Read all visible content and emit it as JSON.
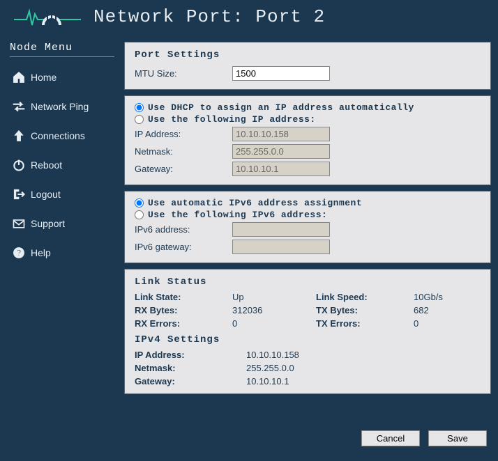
{
  "header": {
    "title": "Network Port: Port 2"
  },
  "sidebar": {
    "heading": "Node Menu",
    "items": [
      {
        "label": "Home"
      },
      {
        "label": "Network Ping"
      },
      {
        "label": "Connections"
      },
      {
        "label": "Reboot"
      },
      {
        "label": "Logout"
      },
      {
        "label": "Support"
      },
      {
        "label": "Help"
      }
    ]
  },
  "port_settings": {
    "heading": "Port Settings",
    "mtu_label": "MTU Size:",
    "mtu_value": "1500"
  },
  "ipv4_config": {
    "radio_dhcp": "Use DHCP to assign an IP address automatically",
    "radio_static": "Use the following IP address:",
    "selected": "dhcp",
    "ip_label": "IP Address:",
    "ip_value": "10.10.10.158",
    "netmask_label": "Netmask:",
    "netmask_value": "255.255.0.0",
    "gateway_label": "Gateway:",
    "gateway_value": "10.10.10.1"
  },
  "ipv6_config": {
    "radio_auto": "Use automatic IPv6 address assignment",
    "radio_static": "Use the following IPv6 address:",
    "selected": "auto",
    "addr_label": "IPv6 address:",
    "addr_value": "",
    "gw_label": "IPv6 gateway:",
    "gw_value": ""
  },
  "link_status": {
    "heading": "Link Status",
    "link_state_k": "Link State:",
    "link_state_v": "Up",
    "link_speed_k": "Link Speed:",
    "link_speed_v": "10Gb/s",
    "rx_bytes_k": "RX Bytes:",
    "rx_bytes_v": "312036",
    "tx_bytes_k": "TX Bytes:",
    "tx_bytes_v": "682",
    "rx_err_k": "RX Errors:",
    "rx_err_v": "0",
    "tx_err_k": "TX Errors:",
    "tx_err_v": "0",
    "ipv4_heading": "IPv4 Settings",
    "ip_k": "IP Address:",
    "ip_v": "10.10.10.158",
    "nm_k": "Netmask:",
    "nm_v": "255.255.0.0",
    "gw_k": "Gateway:",
    "gw_v": "10.10.10.1"
  },
  "footer": {
    "cancel": "Cancel",
    "save": "Save"
  }
}
